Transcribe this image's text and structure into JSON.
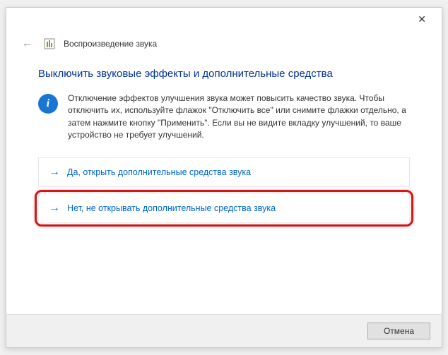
{
  "titlebar": {
    "close_symbol": "✕"
  },
  "header": {
    "back_symbol": "←",
    "breadcrumb": "Воспроизведение звука"
  },
  "main": {
    "heading": "Выключить звуковые эффекты и дополнительные средства",
    "info_text": "Отключение эффектов улучшения звука может повысить качество звука. Чтобы отключить их, используйте флажок \"Отключить все\" или снимите флажки отдельно, а затем нажмите кнопку \"Применить\". Если вы не видите вкладку улучшений, то ваше устройство не требует улучшений.",
    "info_icon_symbol": "i",
    "options": {
      "yes": {
        "arrow": "→",
        "label": "Да, открыть дополнительные средства звука"
      },
      "no": {
        "arrow": "→",
        "label": "Нет, не открывать дополнительные средства звука"
      }
    }
  },
  "footer": {
    "cancel_label": "Отмена"
  }
}
